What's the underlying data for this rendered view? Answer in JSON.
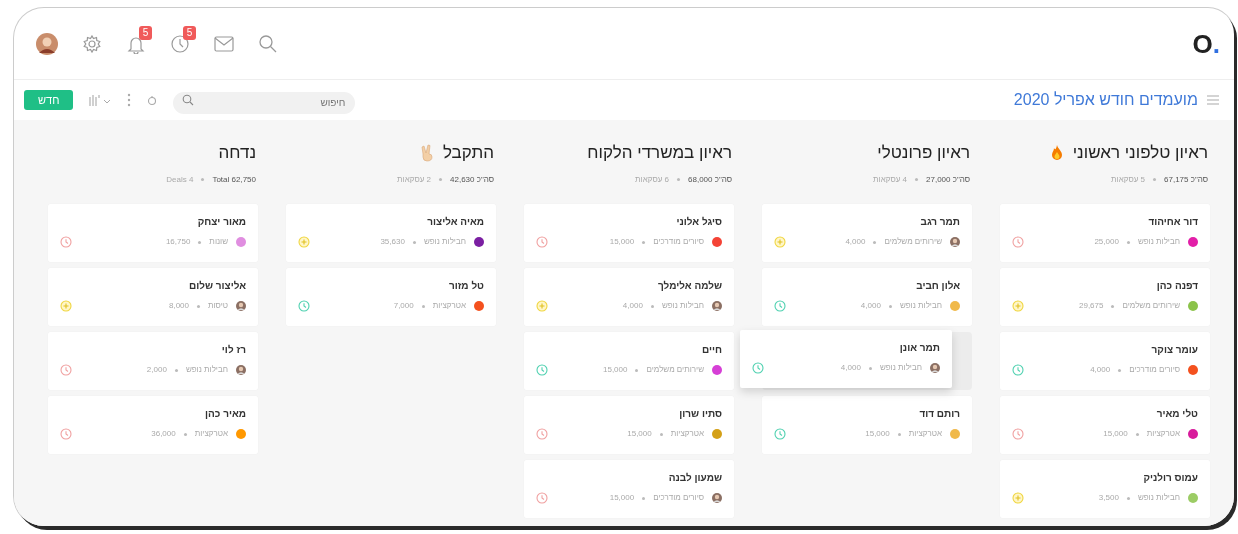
{
  "top_bar": {
    "logo": {
      "text": "O",
      "dot": "."
    },
    "notifications_count": "5",
    "reminders_count": "5"
  },
  "toolbar": {
    "title": "מועמדים חודש אפריל 2020",
    "new_button": "חדש",
    "search": {
      "placeholder": "חיפוש"
    }
  },
  "columns": [
    {
      "title": "ראיון טלפוני ראשוני",
      "title_icon": {
        "kind": "fire"
      },
      "total": "סה\"כ 67,175",
      "count": "5 עסקאות",
      "cards": [
        {
          "kind": "deal",
          "name": "דור אחיהוד",
          "avatar": {
            "kind": "color",
            "color": "#e21fa8"
          },
          "tag": "חבילות נופש",
          "amount": "25,000",
          "status": {
            "kind": "late"
          }
        },
        {
          "kind": "deal",
          "name": "דפנה כהן",
          "avatar": {
            "kind": "color",
            "color": "#8bc34a"
          },
          "tag": "שירותים משלמים",
          "amount": "29,675",
          "status": {
            "kind": "add"
          }
        },
        {
          "kind": "deal",
          "name": "עומר צוקר",
          "avatar": {
            "kind": "color",
            "color": "#f4511e"
          },
          "tag": "סיורים מודרכים",
          "amount": "4,000",
          "status": {
            "kind": "on_time"
          }
        },
        {
          "kind": "deal",
          "name": "טלי מאיר",
          "avatar": {
            "kind": "color",
            "color": "#d81b9c"
          },
          "tag": "אטרקציות",
          "amount": "15,000",
          "status": {
            "kind": "late"
          }
        },
        {
          "kind": "deal",
          "name": "עמוס רולניק",
          "avatar": {
            "kind": "color",
            "color": "#9ccc65"
          },
          "tag": "חבילות נופש",
          "amount": "3,500",
          "status": {
            "kind": "add"
          }
        }
      ]
    },
    {
      "title": "ראיון פרונטלי",
      "total": "סה\"כ 27,000",
      "count": "4 עסקאות",
      "cards": [
        {
          "kind": "deal",
          "name": "תמר רגב",
          "avatar": {
            "kind": "photo"
          },
          "tag": "שירותים משלמים",
          "amount": "4,000",
          "status": {
            "kind": "add"
          }
        },
        {
          "kind": "deal",
          "name": "אלון חביב",
          "avatar": {
            "kind": "color",
            "color": "#f0b94a"
          },
          "tag": "חבילות נופש",
          "amount": "4,000",
          "status": {
            "kind": "on_time"
          }
        },
        {
          "kind": "placeholder"
        },
        {
          "kind": "deal",
          "name": "רותם דוד",
          "avatar": {
            "kind": "color",
            "color": "#f0b94a"
          },
          "tag": "אטרקציות",
          "amount": "15,000",
          "status": {
            "kind": "on_time"
          }
        }
      ]
    },
    {
      "title": "ראיון במשרדי הלקוח",
      "total": "סה\"כ 68,000",
      "count": "6 עסקאות",
      "cards": [
        {
          "kind": "deal",
          "name": "סיגל אלוני",
          "avatar": {
            "kind": "color",
            "color": "#f44336"
          },
          "tag": "סיורים מודרכים",
          "amount": "15,000",
          "status": {
            "kind": "late"
          }
        },
        {
          "kind": "deal",
          "name": "שלמה אלימלך",
          "avatar": {
            "kind": "photo"
          },
          "tag": "חבילות נופש",
          "amount": "4,000",
          "status": {
            "kind": "add"
          }
        },
        {
          "kind": "deal",
          "name": "חיים",
          "avatar": {
            "kind": "color",
            "color": "#d63fd6"
          },
          "tag": "שירותים משלמים",
          "amount": "15,000",
          "status": {
            "kind": "on_time"
          }
        },
        {
          "kind": "deal",
          "name": "סתיו שרון",
          "avatar": {
            "kind": "color",
            "color": "#d4a017"
          },
          "tag": "אטרקציות",
          "amount": "15,000",
          "status": {
            "kind": "late"
          }
        },
        {
          "kind": "deal",
          "name": "שמעון לבנה",
          "avatar": {
            "kind": "photo"
          },
          "tag": "סיורים מודרכים",
          "amount": "15,000",
          "status": {
            "kind": "late"
          }
        }
      ]
    },
    {
      "title": "התקבל",
      "title_icon": {
        "kind": "victory"
      },
      "total": "סה\"כ 42,630",
      "count": "2 עסקאות",
      "cards": [
        {
          "kind": "deal",
          "name": "מאיה אליצור",
          "avatar": {
            "kind": "color",
            "color": "#7b1fa2"
          },
          "tag": "חבילות נופש",
          "amount": "35,630",
          "status": {
            "kind": "add"
          }
        },
        {
          "kind": "deal",
          "name": "טל מזור",
          "avatar": {
            "kind": "color",
            "color": "#f4511e"
          },
          "tag": "אטרקציות",
          "amount": "7,000",
          "status": {
            "kind": "on_time"
          }
        }
      ]
    },
    {
      "title": "נדחה",
      "total": "Total 62,750",
      "count": "4 Deals",
      "cards": [
        {
          "kind": "deal",
          "name": "מאור יצחק",
          "avatar": {
            "kind": "color",
            "color": "#e08ee0"
          },
          "tag": "שונות",
          "amount": "16,750",
          "status": {
            "kind": "late"
          }
        },
        {
          "kind": "deal",
          "name": "אליצור שלום",
          "avatar": {
            "kind": "photo"
          },
          "tag": "טיסות",
          "amount": "8,000",
          "status": {
            "kind": "add"
          }
        },
        {
          "kind": "deal",
          "name": "רז לוי",
          "avatar": {
            "kind": "photo"
          },
          "tag": "חבילות נופש",
          "amount": "2,000",
          "status": {
            "kind": "late"
          }
        },
        {
          "kind": "deal",
          "name": "מאיר כהן",
          "avatar": {
            "kind": "color",
            "color": "#ff9800"
          },
          "tag": "אטרקציות",
          "amount": "36,000",
          "status": {
            "kind": "late"
          }
        }
      ]
    }
  ],
  "dragged_card": {
    "name": "תמר אונן",
    "avatar": {
      "kind": "photo"
    },
    "tag": "חבילות נופש",
    "amount": "4,000",
    "status": {
      "kind": "on_time"
    }
  }
}
